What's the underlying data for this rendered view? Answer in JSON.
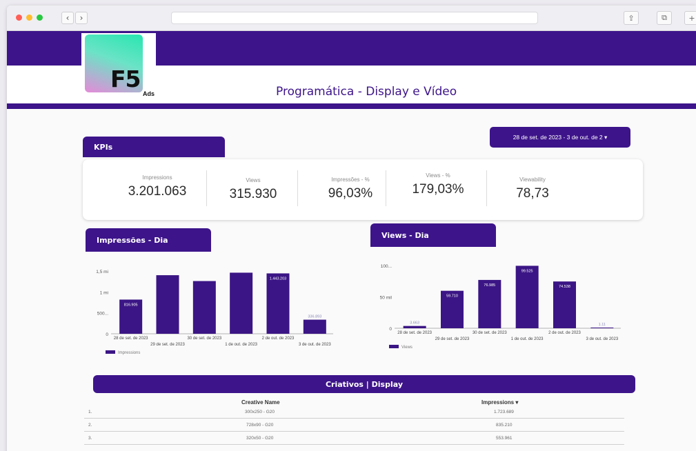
{
  "browser": {
    "traffic_lights": [
      "#ff5f57",
      "#febc2e",
      "#28c840"
    ],
    "back_label": "‹",
    "forward_label": "›",
    "share_label": "⇪",
    "tabs_label": "⧉",
    "new_tab_label": "+"
  },
  "header": {
    "logo_text": "F5",
    "logo_sub": "Ads",
    "title": "Programática - Display e Vídeo"
  },
  "date_range": {
    "label": "28 de set. de 2023 - 3 de out. de 2  ▾"
  },
  "kpis": {
    "section_label": "KPIs",
    "items": [
      {
        "label": "Impressions",
        "value": "3.201.063"
      },
      {
        "label": "Views",
        "value": "315.930"
      },
      {
        "label": "Impressões - %",
        "value": "96,03%"
      },
      {
        "label": "Views - %",
        "value": "179,03%"
      },
      {
        "label": "Viewability",
        "value": "78,73"
      }
    ]
  },
  "colors": {
    "brand": "#3d148a",
    "bar": "#3b1585"
  },
  "chart_data": [
    {
      "type": "bar",
      "title": "Impressões - Dia",
      "categories": [
        "28 de set. de 2023",
        "29 de set. de 2023",
        "30 de set. de 2023",
        "1 de out. de 2023",
        "2 de out. de 2023",
        "3 de out. de 2023"
      ],
      "series": [
        {
          "name": "Impressions",
          "values": [
            816905,
            1400000,
            1260000,
            1460000,
            1443203,
            336893
          ]
        }
      ],
      "data_labels": [
        "816.905",
        "",
        "",
        "",
        "1.443.203",
        "336.893"
      ],
      "y_ticks": [
        "1,5 mi",
        "1 mi",
        "500...",
        "0"
      ],
      "ylim": [
        0,
        1500000
      ],
      "legend": "bottom-left"
    },
    {
      "type": "bar",
      "title": "Views - Dia",
      "categories": [
        "28 de set. de 2023",
        "29 de set. de 2023",
        "30 de set. de 2023",
        "1 de out. de 2023",
        "2 de out. de 2023",
        "3 de out. de 2023"
      ],
      "series": [
        {
          "name": "Views",
          "values": [
            3663,
            59710,
            76985,
            99525,
            74538,
            1111
          ]
        }
      ],
      "data_labels": [
        "3.663",
        "59.710",
        "76.985",
        "99.525",
        "74.538",
        "1.11"
      ],
      "y_ticks": [
        "100...",
        "50 mil",
        "0"
      ],
      "ylim": [
        0,
        100000
      ],
      "legend": "bottom-left"
    }
  ],
  "table": {
    "title": "Criativos |  Display",
    "col_name": "Creative Name",
    "col_impr": "Impressions  ▾",
    "rows": [
      {
        "idx": "1.",
        "name": "300x250 - G20",
        "impressions": "1.723.689"
      },
      {
        "idx": "2.",
        "name": "728x90 - G20",
        "impressions": "835.210"
      },
      {
        "idx": "3.",
        "name": "320x50 - G20",
        "impressions": "553.961"
      }
    ]
  }
}
